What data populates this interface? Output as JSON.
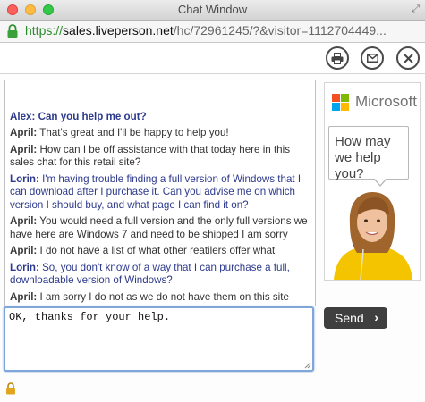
{
  "window": {
    "title": "Chat Window"
  },
  "address_bar": {
    "scheme": "https://",
    "domain": "sales.liveperson.net",
    "path": "/hc/72961245/?&visitor=1112704449..."
  },
  "toolbar": {
    "print_icon": "printer-icon",
    "email_icon": "envelope-icon",
    "close_icon": "close-icon"
  },
  "transcript": {
    "cut_line": "Alex: Can you help me out?",
    "messages": [
      {
        "sender": "April:",
        "text": "That's great and I'll be happy to help you!",
        "role": "agent"
      },
      {
        "sender": "April:",
        "text": "How can I be off assistance with that today here in this sales chat for this retail site?",
        "role": "agent"
      },
      {
        "sender": "Lorin:",
        "text": "I'm having trouble finding a full version of Windows that I can download after I purchase it. Can you advise me on which version I should buy, and what page I can find it on?",
        "role": "visitor"
      },
      {
        "sender": "April:",
        "text": "You would need a full version and the only full versions we have here are Windows 7 and need to be shipped I am sorry",
        "role": "agent"
      },
      {
        "sender": "April:",
        "text": "I do not have a list of what other reatilers offer what",
        "role": "agent"
      },
      {
        "sender": "Lorin:",
        "text": "So, you don't know of a way that I can purchase a full, downloadable version of Windows?",
        "role": "visitor"
      },
      {
        "sender": "April:",
        "text": "I am sorry I do not as we do not have them on this site",
        "role": "agent"
      }
    ]
  },
  "ad": {
    "brand": "Microsoft",
    "bubble_text": "How may we help you?",
    "colors": {
      "red": "#f25022",
      "green": "#7fba00",
      "blue": "#00a4ef",
      "yellow": "#ffb900",
      "shirt": "#f5c400"
    }
  },
  "composer": {
    "value": "OK, thanks for your help.",
    "send_label": "Send",
    "send_icon": "chevron-right-icon",
    "lock_icon": "lock-icon"
  }
}
